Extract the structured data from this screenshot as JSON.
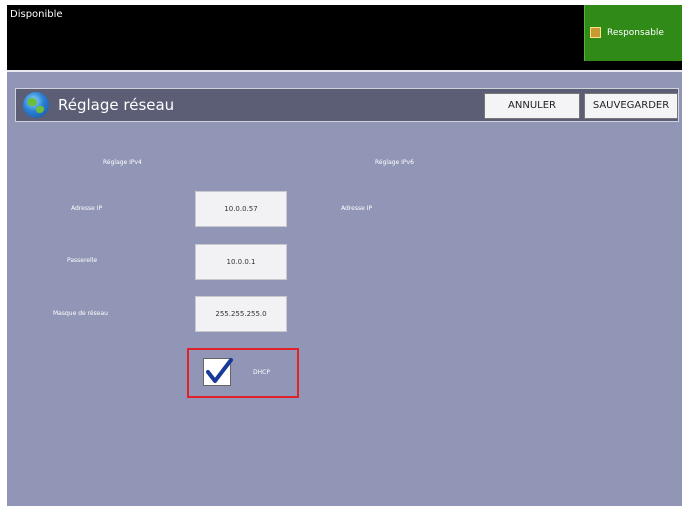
{
  "status_bar": {
    "text": "Disponible"
  },
  "user_button": {
    "label": "Responsable",
    "icon": "user-icon"
  },
  "header": {
    "title": "Réglage réseau",
    "cancel_label": "ANNULER",
    "save_label": "SAUVEGARDER"
  },
  "columns": {
    "left_title": "Réglage IPv4",
    "right_title": "Réglage IPv6"
  },
  "fields": [
    {
      "label": "Adresse IP",
      "value": "10.0.0.57"
    },
    {
      "label": "Passerelle",
      "value": "10.0.0.1"
    },
    {
      "label": "Masque de réseau",
      "value": "255.255.255.0"
    }
  ],
  "right_fields": [
    {
      "label": "Adresse IP"
    }
  ],
  "dhcp": {
    "label": "DHCP",
    "checked": true
  },
  "colors": {
    "panel": "#9196b6",
    "titlebar": "#5b5e74",
    "user_button": "#2f8a17",
    "highlight": "#e0232a"
  }
}
